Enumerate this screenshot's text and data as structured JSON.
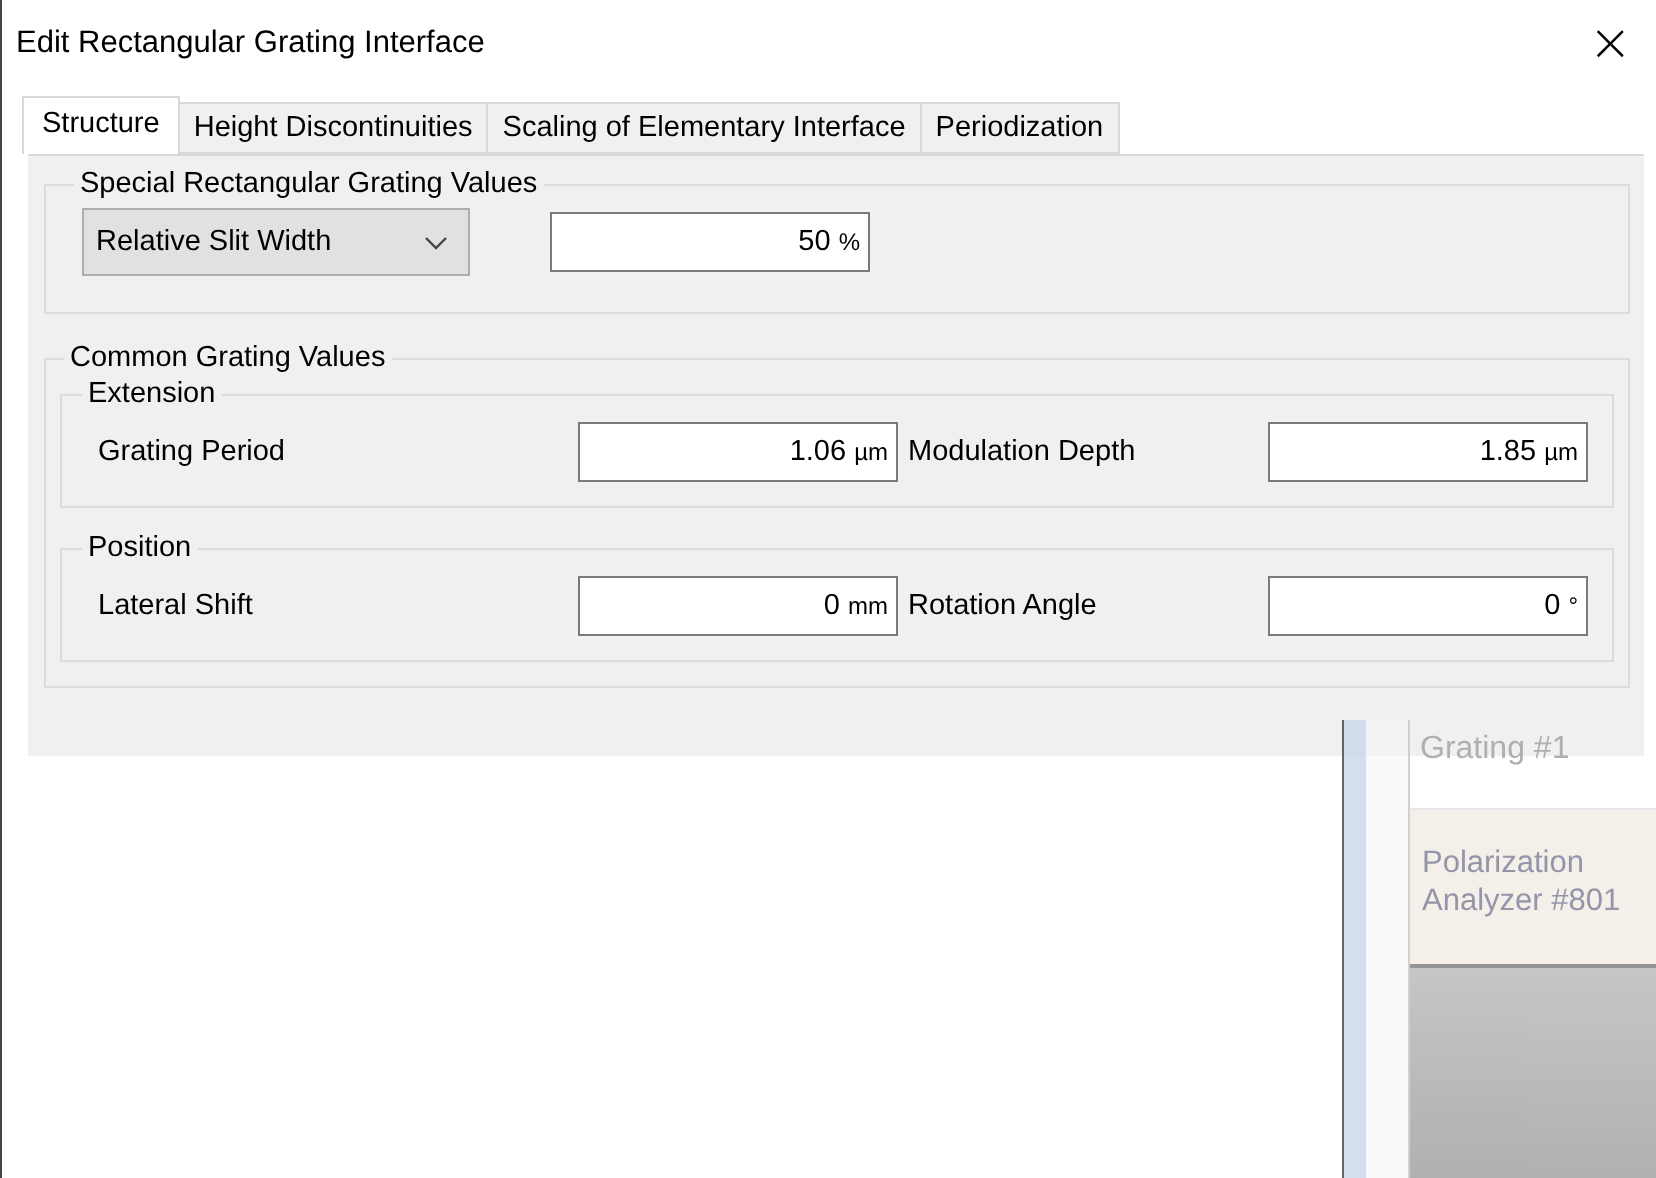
{
  "window": {
    "title": "Edit Rectangular Grating Interface",
    "close": "×"
  },
  "tabs": [
    {
      "label": "Structure",
      "selected": true
    },
    {
      "label": "Height Discontinuities",
      "selected": false
    },
    {
      "label": "Scaling of Elementary Interface",
      "selected": false
    },
    {
      "label": "Periodization",
      "selected": false
    }
  ],
  "special_group": {
    "title": "Special Rectangular Grating Values",
    "dropdown": {
      "value": "Relative Slit Width"
    },
    "field": {
      "value": "50",
      "unit": "%"
    }
  },
  "common_group": {
    "title": "Common Grating Values",
    "subgroups": [
      {
        "title": "Extension",
        "fields": [
          {
            "label": "Grating Period",
            "value": "1.06",
            "unit": "µm"
          },
          {
            "label": "Modulation Depth",
            "value": "1.85",
            "unit": "µm"
          }
        ]
      },
      {
        "title": "Position",
        "fields": [
          {
            "label": "Lateral Shift",
            "value": "0",
            "unit": "mm"
          },
          {
            "label": "Rotation Angle",
            "value": "0",
            "unit": "°"
          }
        ]
      }
    ]
  },
  "background_window": {
    "items": [
      "Grating #1",
      "Polarization Analyzer #801"
    ]
  }
}
